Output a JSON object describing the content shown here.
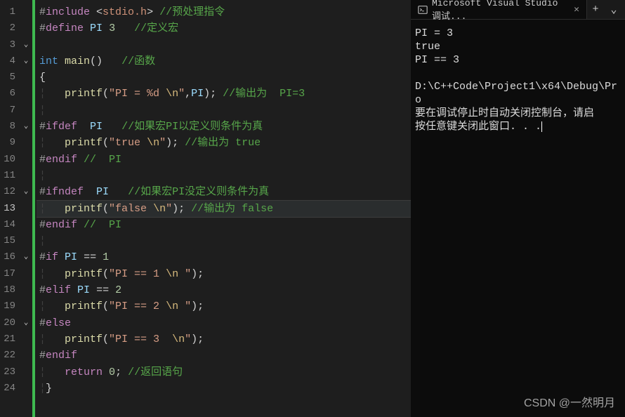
{
  "editor": {
    "lineCount": 24,
    "currentLine": 13,
    "folds": {
      "3": "v",
      "4": "v",
      "8": "v",
      "12": "v",
      "16": "v",
      "20": "v"
    },
    "lines": {
      "1": {
        "segs": [
          [
            "pp",
            "#"
          ],
          [
            "ppk",
            "include"
          ],
          [
            "pn",
            " <"
          ],
          [
            "inc",
            "stdio.h"
          ],
          [
            "pn",
            ">"
          ],
          [
            "cmt",
            " //预处理指令"
          ]
        ]
      },
      "2": {
        "segs": [
          [
            "pp",
            "#"
          ],
          [
            "ppk",
            "define"
          ],
          [
            "pn",
            " "
          ],
          [
            "def",
            "PI"
          ],
          [
            "pn",
            " "
          ],
          [
            "num",
            "3"
          ],
          [
            "pn",
            "   "
          ],
          [
            "cmt",
            "//定义宏"
          ]
        ]
      },
      "3": {
        "segs": [
          [
            "pn",
            ""
          ]
        ]
      },
      "4": {
        "segs": [
          [
            "kw",
            "int"
          ],
          [
            "pn",
            " "
          ],
          [
            "fn",
            "main"
          ],
          [
            "pn",
            "()   "
          ],
          [
            "cmt",
            "//函数"
          ]
        ]
      },
      "5": {
        "segs": [
          [
            "pn",
            "{"
          ]
        ]
      },
      "6": {
        "segs": [
          [
            "guide",
            "¦   "
          ],
          [
            "fn",
            "printf"
          ],
          [
            "pn",
            "("
          ],
          [
            "str",
            "\"PI = %d "
          ],
          [
            "esc",
            "\\n"
          ],
          [
            "str",
            "\""
          ],
          [
            "pn",
            ","
          ],
          [
            "def",
            "PI"
          ],
          [
            "pn",
            "); "
          ],
          [
            "cmt",
            "//输出为  PI=3"
          ]
        ]
      },
      "7": {
        "segs": [
          [
            "guide",
            "¦"
          ]
        ]
      },
      "8": {
        "segs": [
          [
            "pp",
            "#"
          ],
          [
            "ppk",
            "ifdef"
          ],
          [
            "pn",
            "  "
          ],
          [
            "def",
            "PI"
          ],
          [
            "pn",
            "   "
          ],
          [
            "cmt",
            "//如果宏PI以定义则条件为真"
          ]
        ]
      },
      "9": {
        "segs": [
          [
            "guide",
            "¦   "
          ],
          [
            "fn",
            "printf"
          ],
          [
            "pn",
            "("
          ],
          [
            "str",
            "\"true "
          ],
          [
            "esc",
            "\\n"
          ],
          [
            "str",
            "\""
          ],
          [
            "pn",
            "); "
          ],
          [
            "cmt",
            "//输出为 true"
          ]
        ]
      },
      "10": {
        "segs": [
          [
            "pp",
            "#"
          ],
          [
            "ppk",
            "endif"
          ],
          [
            "pn",
            " "
          ],
          [
            "cmt",
            "//  PI"
          ]
        ]
      },
      "11": {
        "segs": [
          [
            "guide",
            "¦"
          ]
        ]
      },
      "12": {
        "segs": [
          [
            "pp",
            "#"
          ],
          [
            "ppk",
            "ifndef"
          ],
          [
            "pn",
            "  "
          ],
          [
            "def",
            "PI"
          ],
          [
            "pn",
            "   "
          ],
          [
            "cmt",
            "//如果宏PI没定义则条件为真"
          ]
        ]
      },
      "13": {
        "segs": [
          [
            "guide",
            "¦   "
          ],
          [
            "fn",
            "printf"
          ],
          [
            "pn",
            "("
          ],
          [
            "str",
            "\"false "
          ],
          [
            "esc",
            "\\n"
          ],
          [
            "str",
            "\""
          ],
          [
            "pn",
            "); "
          ],
          [
            "cmt",
            "//输出为 false"
          ]
        ]
      },
      "14": {
        "segs": [
          [
            "pp",
            "#"
          ],
          [
            "ppk",
            "endif"
          ],
          [
            "pn",
            " "
          ],
          [
            "cmt",
            "//  PI"
          ]
        ]
      },
      "15": {
        "segs": [
          [
            "guide",
            "¦"
          ]
        ]
      },
      "16": {
        "segs": [
          [
            "pp",
            "#"
          ],
          [
            "ppk",
            "if"
          ],
          [
            "pn",
            " "
          ],
          [
            "def",
            "PI"
          ],
          [
            "pn",
            " "
          ],
          [
            "op",
            "=="
          ],
          [
            "pn",
            " "
          ],
          [
            "num",
            "1"
          ]
        ]
      },
      "17": {
        "segs": [
          [
            "guide",
            "¦   "
          ],
          [
            "fn",
            "printf"
          ],
          [
            "pn",
            "("
          ],
          [
            "str",
            "\"PI == 1 "
          ],
          [
            "esc",
            "\\n"
          ],
          [
            "str",
            " \""
          ],
          [
            "pn",
            ");"
          ]
        ]
      },
      "18": {
        "segs": [
          [
            "pp",
            "#"
          ],
          [
            "ppk",
            "elif"
          ],
          [
            "pn",
            " "
          ],
          [
            "def",
            "PI"
          ],
          [
            "pn",
            " "
          ],
          [
            "op",
            "=="
          ],
          [
            "pn",
            " "
          ],
          [
            "num",
            "2"
          ]
        ]
      },
      "19": {
        "segs": [
          [
            "guide",
            "¦   "
          ],
          [
            "fn",
            "printf"
          ],
          [
            "pn",
            "("
          ],
          [
            "str",
            "\"PI == 2 "
          ],
          [
            "esc",
            "\\n"
          ],
          [
            "str",
            " \""
          ],
          [
            "pn",
            ");"
          ]
        ]
      },
      "20": {
        "segs": [
          [
            "pp",
            "#"
          ],
          [
            "ppk",
            "else"
          ]
        ]
      },
      "21": {
        "segs": [
          [
            "guide",
            "¦   "
          ],
          [
            "fn",
            "printf"
          ],
          [
            "pn",
            "("
          ],
          [
            "str",
            "\"PI == 3  "
          ],
          [
            "esc",
            "\\n"
          ],
          [
            "str",
            "\""
          ],
          [
            "pn",
            ");"
          ]
        ]
      },
      "22": {
        "segs": [
          [
            "pp",
            "#"
          ],
          [
            "ppk",
            "endif"
          ]
        ]
      },
      "23": {
        "segs": [
          [
            "guide",
            "¦   "
          ],
          [
            "kw2",
            "return"
          ],
          [
            "pn",
            " "
          ],
          [
            "num",
            "0"
          ],
          [
            "pn",
            "; "
          ],
          [
            "cmt",
            "//返回语句"
          ]
        ]
      },
      "24": {
        "segs": [
          [
            "guide",
            "¦"
          ],
          [
            "pn",
            "}"
          ]
        ]
      }
    }
  },
  "terminal": {
    "tabTitle": "Microsoft Visual Studio 调试...",
    "output": {
      "l1": "PI = 3",
      "l2": "true",
      "l3": "PI == 3",
      "blank": "",
      "path": "D:\\C++Code\\Project1\\x64\\Debug\\Pro",
      "msg1": "要在调试停止时自动关闭控制台，请启",
      "msg2": "按任意键关闭此窗口. . ."
    }
  },
  "watermark": "CSDN @一然明月"
}
